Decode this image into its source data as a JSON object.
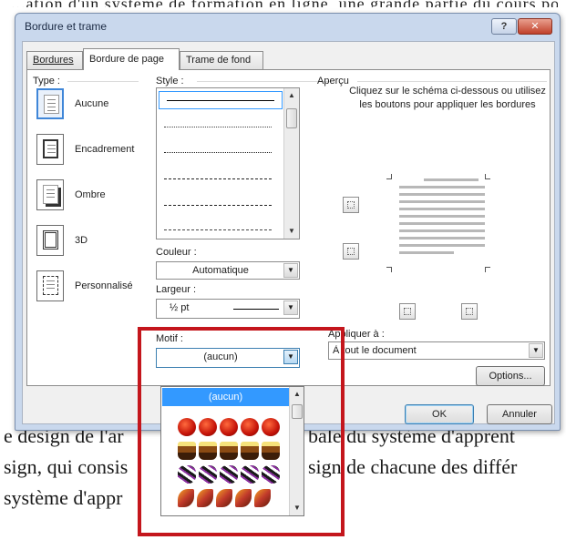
{
  "document": {
    "top_text": "...ation d'un système de formation en ligne, une grande partie du cours pour les ...",
    "line1": "e design de l'ar",
    "line1b": "bale du système d'apprent",
    "line2": "sign, qui consis",
    "line2b": "sign de chacune des différ",
    "line3": " système d'appr"
  },
  "dialog": {
    "title": "Bordure et trame",
    "help_label": "?",
    "close_label": "✕"
  },
  "tabs": [
    {
      "label": "Bordures",
      "active": false
    },
    {
      "label": "Bordure de page",
      "active": true
    },
    {
      "label": "Trame de fond",
      "active": false
    }
  ],
  "type_section": {
    "label": "Type :",
    "options": [
      {
        "label": "Aucune",
        "selected": true
      },
      {
        "label": "Encadrement",
        "selected": false
      },
      {
        "label": "Ombre",
        "selected": false
      },
      {
        "label": "3D",
        "selected": false
      },
      {
        "label": "Personnalisé",
        "selected": false
      }
    ]
  },
  "style_section": {
    "label": "Style :"
  },
  "color_section": {
    "label": "Couleur :",
    "value": "Automatique"
  },
  "width_section": {
    "label": "Largeur :",
    "value": "½ pt"
  },
  "motif_section": {
    "label": "Motif :",
    "value": "(aucun)",
    "options": [
      "(aucun)",
      "apple-art",
      "cake-art",
      "ball-art",
      "leaf-art"
    ]
  },
  "preview": {
    "label": "Aperçu",
    "hint": "Cliquez sur le schéma ci-dessous ou utilisez les boutons pour appliquer les bordures"
  },
  "apply_to": {
    "label": "Appliquer à :",
    "value": "À tout le document"
  },
  "buttons": {
    "options": "Options...",
    "ok": "OK",
    "cancel": "Annuler"
  },
  "colors": {
    "selection": "#3399ff",
    "highlight_frame": "#c4161c",
    "dialog_chrome": "#c9d8ed"
  }
}
